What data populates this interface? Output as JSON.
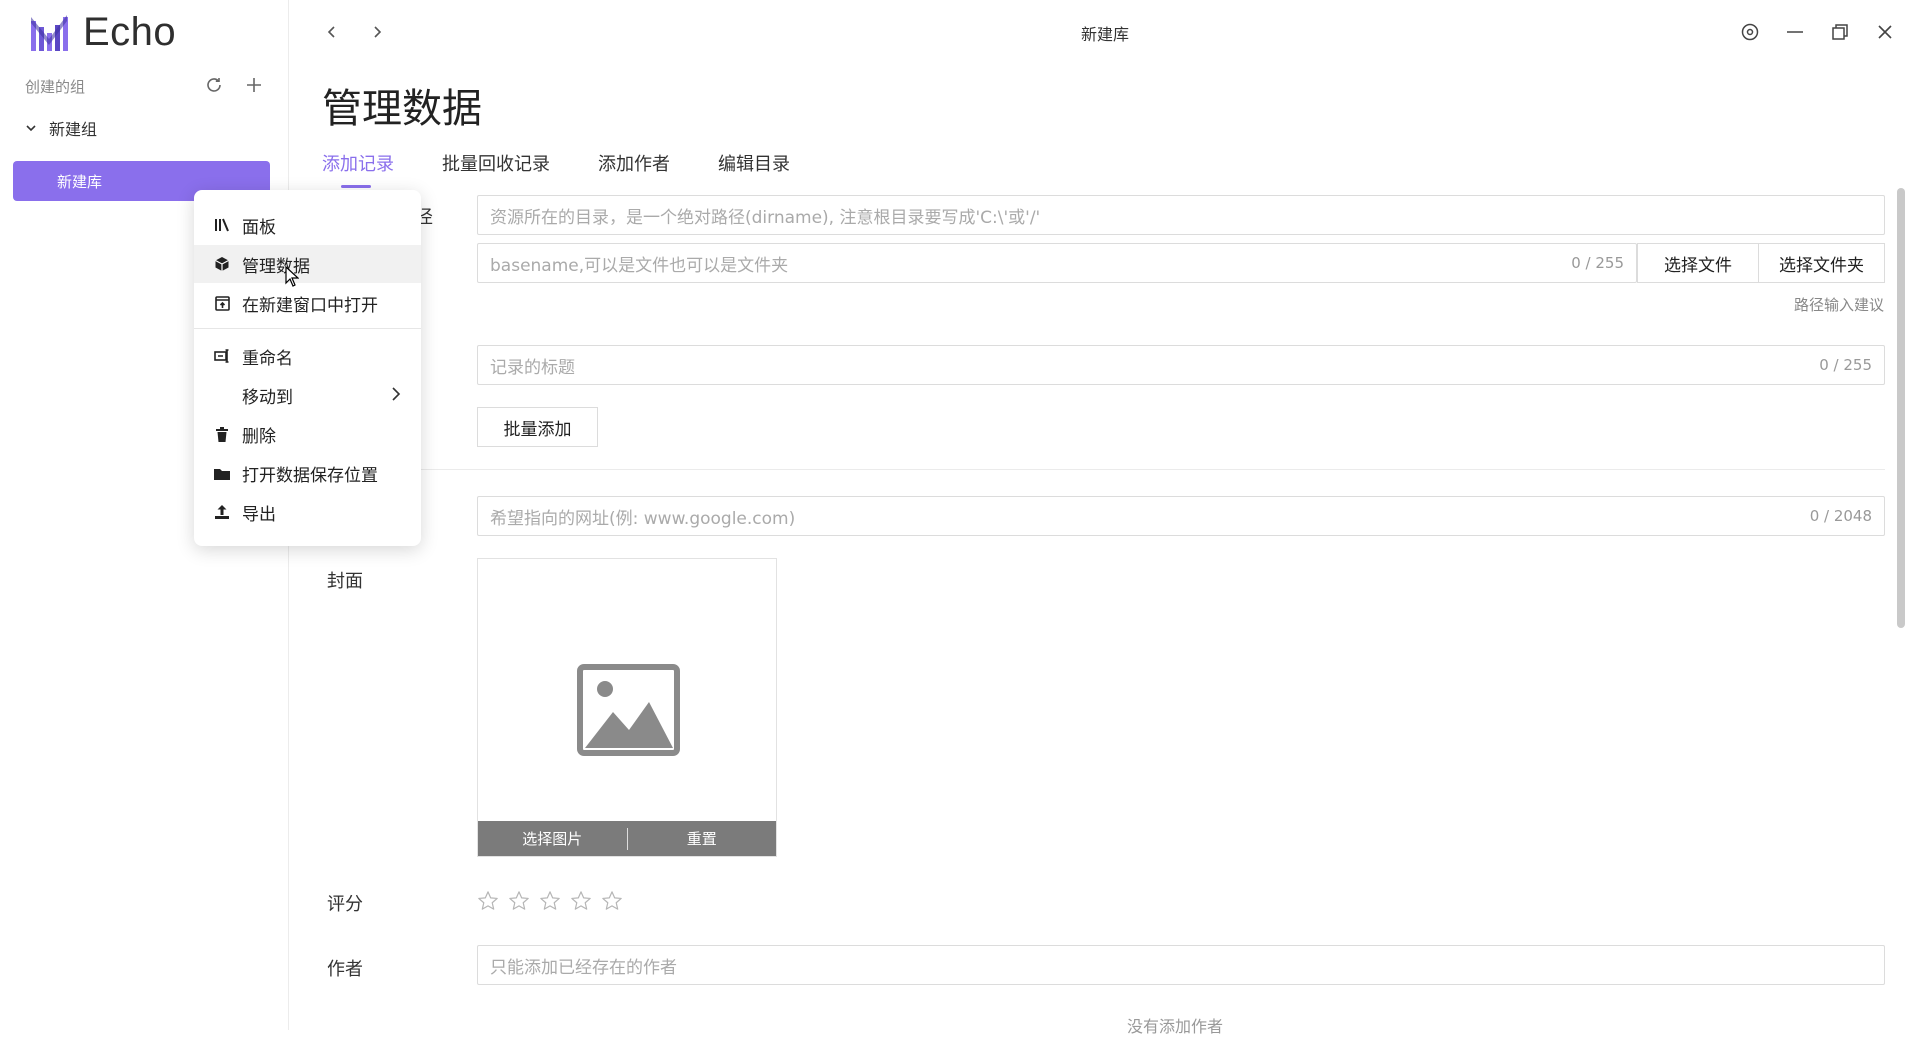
{
  "app": {
    "name": "Echo",
    "accent": "#8a6fec"
  },
  "sidebar": {
    "group_header": "创建的组",
    "group_name": "新建组",
    "library_name": "新建库"
  },
  "titlebar": {
    "title": "新建库"
  },
  "main": {
    "page_title": "管理数据",
    "tabs": [
      {
        "label": "添加记录",
        "active": true
      },
      {
        "label": "批量回收记录",
        "active": false
      },
      {
        "label": "添加作者",
        "active": false
      },
      {
        "label": "编辑目录",
        "active": false
      }
    ],
    "path_label_fragment": "径",
    "dir_placeholder": "资源所在的目录，是一个绝对路径(dirname), 注意根目录要写成'C:\\'或'/'",
    "basename_placeholder": "basename,可以是文件也可以是文件夹",
    "basename_counter": "0 / 255",
    "select_file_label": "选择文件",
    "select_folder_label": "选择文件夹",
    "path_hint": "路径输入建议",
    "title_placeholder": "记录的标题",
    "title_counter": "0 / 255",
    "batch_add_label": "批量添加",
    "url_placeholder": "希望指向的网址(例: www.google.com)",
    "url_counter": "0 / 2048",
    "cover_label": "封面",
    "cover_select_label": "选择图片",
    "cover_reset_label": "重置",
    "rating_label": "评分",
    "rating_value": 0,
    "rating_max": 5,
    "author_label": "作者",
    "author_placeholder": "只能添加已经存在的作者",
    "no_author_text": "没有添加作者"
  },
  "context_menu": {
    "items": [
      {
        "label": "面板",
        "icon": "library-icon"
      },
      {
        "label": "管理数据",
        "icon": "cube-icon",
        "hover": true
      },
      {
        "label": "在新建窗口中打开",
        "icon": "open-window-icon"
      },
      {
        "label": "重命名",
        "icon": "rename-icon"
      },
      {
        "label": "移动到",
        "icon": "",
        "submenu": true
      },
      {
        "label": "删除",
        "icon": "trash-icon"
      },
      {
        "label": "打开数据保存位置",
        "icon": "folder-icon"
      },
      {
        "label": "导出",
        "icon": "export-icon"
      }
    ]
  }
}
